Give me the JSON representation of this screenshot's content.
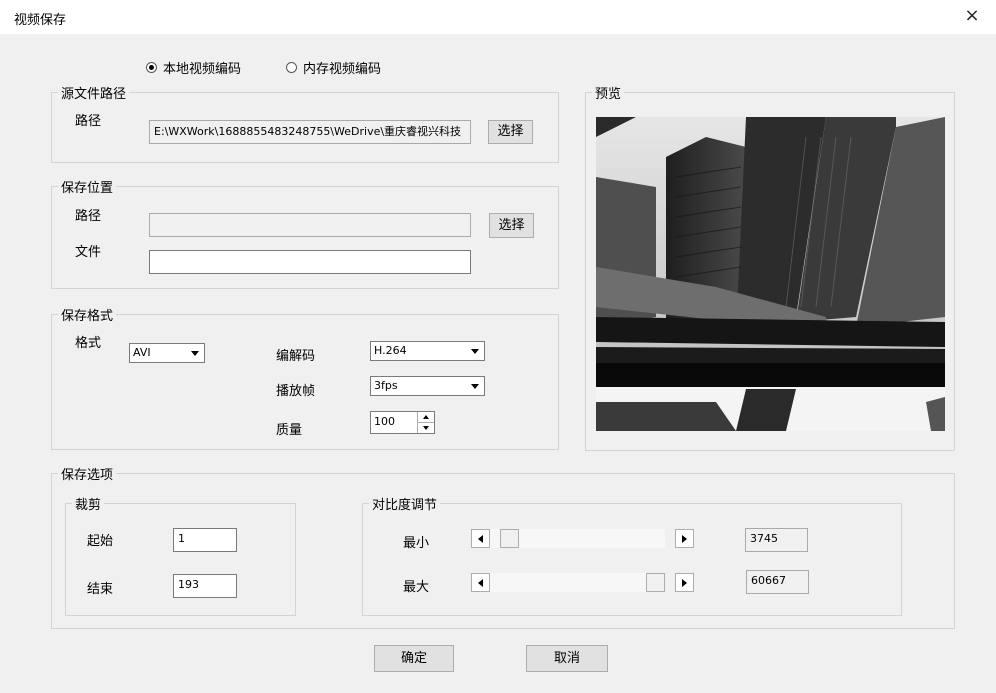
{
  "window": {
    "title": "视频保存",
    "close_icon": "×"
  },
  "encode_mode": {
    "options": [
      {
        "label": "本地视频编码",
        "checked": true
      },
      {
        "label": "内存视频编码",
        "checked": false
      }
    ]
  },
  "source": {
    "legend": "源文件路径",
    "path_label": "路径",
    "path_value": "E:\\WXWork\\1688855483248755\\WeDrive\\重庆睿视兴科技",
    "select_label": "选择"
  },
  "save_location": {
    "legend": "保存位置",
    "path_label": "路径",
    "path_value": "",
    "file_label": "文件",
    "file_value": "",
    "select_label": "选择"
  },
  "save_format": {
    "legend": "保存格式",
    "format_label": "格式",
    "format_value": "AVI",
    "codec_label": "编解码",
    "codec_value": "H.264",
    "fps_label": "播放帧",
    "fps_value": "3fps",
    "quality_label": "质量",
    "quality_value": "100"
  },
  "preview": {
    "legend": "预览"
  },
  "save_options": {
    "legend": "保存选项",
    "crop": {
      "legend": "裁剪",
      "start_label": "起始",
      "start_value": "1",
      "end_label": "结束",
      "end_value": "193"
    },
    "contrast": {
      "legend": "对比度调节",
      "min_label": "最小",
      "min_value": "3745",
      "min_position": 0.0,
      "max_label": "最大",
      "max_value": "60667",
      "max_position": 1.0
    }
  },
  "footer": {
    "ok_label": "确定",
    "cancel_label": "取消"
  }
}
